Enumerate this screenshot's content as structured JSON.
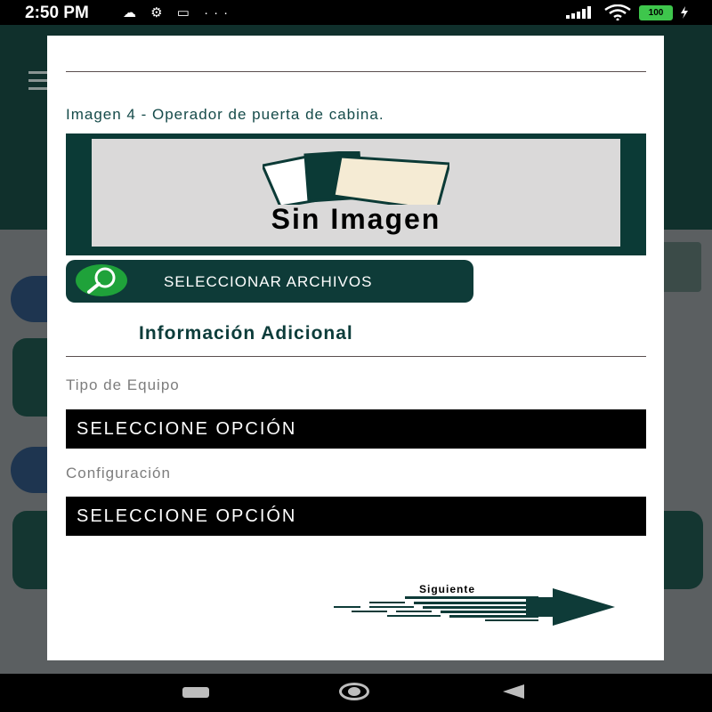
{
  "status_bar": {
    "time": "2:50 PM",
    "left_icons": [
      "chat-bubble-icon",
      "gear-icon",
      "screen-icon",
      "more-dots-icon"
    ],
    "left_icons_text": "☁ ⚙ ▭ ···",
    "battery": "100",
    "right_icons": [
      "signal-icon",
      "wifi-icon",
      "battery-icon",
      "charging-icon"
    ]
  },
  "dialog": {
    "image_caption": "Imagen 4 - Operador de puerta de cabina.",
    "placeholder_text": "Sin Imagen",
    "select_files_label": "SELECCIONAR ARCHIVOS",
    "section_title": "Información Adicional",
    "fields": [
      {
        "label": "Tipo de Equipo",
        "value": "SELECCIONE OPCIÓN"
      },
      {
        "label": "Configuración",
        "value": "SELECCIONE OPCIÓN"
      }
    ],
    "next_label": "Siguiente"
  },
  "colors": {
    "accent_dark_green": "#0e3b38",
    "search_green": "#1fa23a",
    "select_bg": "#000000"
  }
}
